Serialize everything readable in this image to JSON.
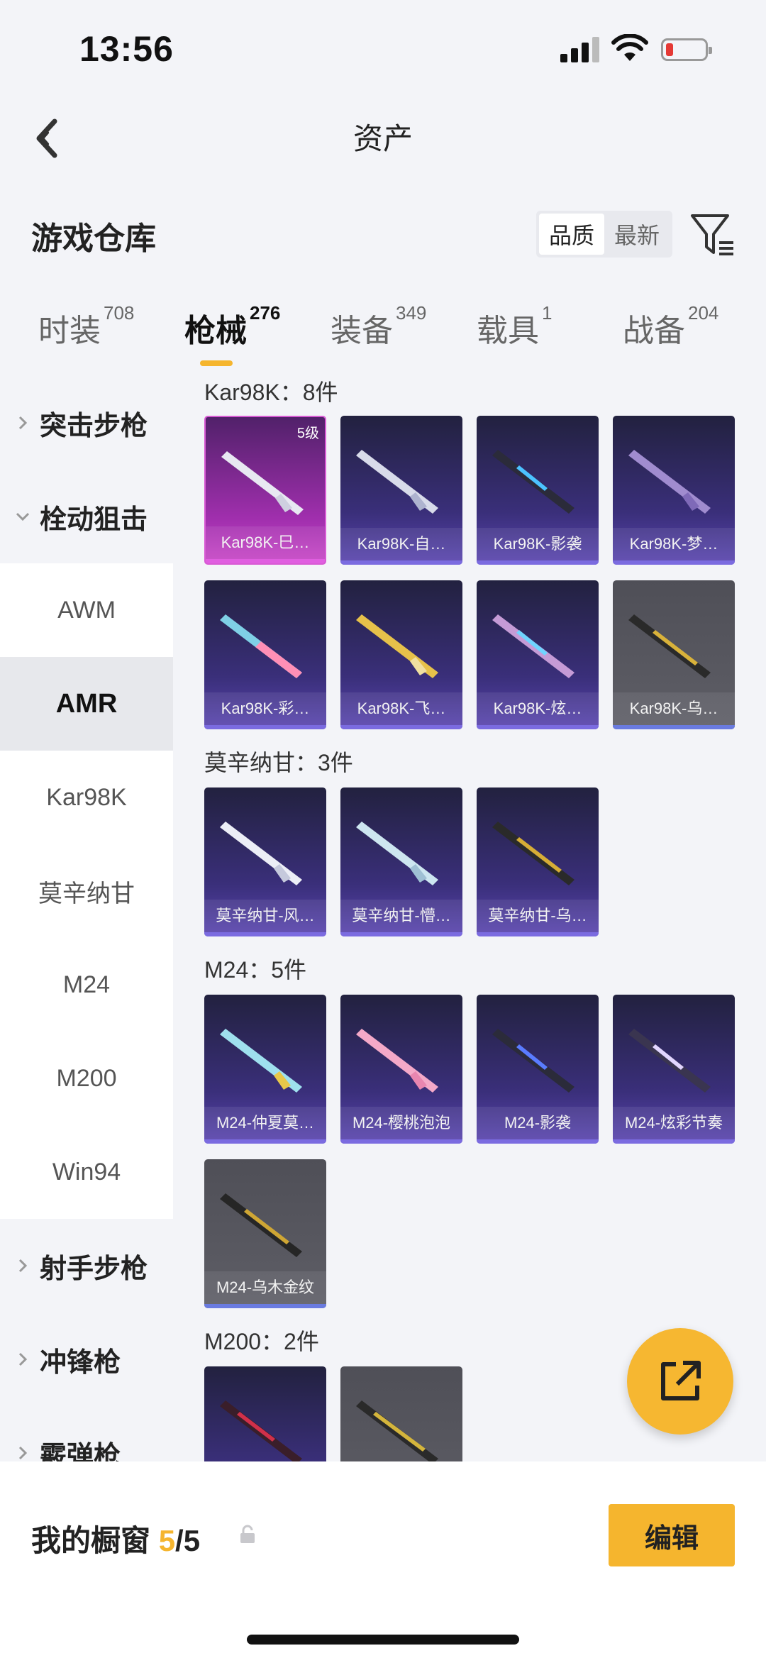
{
  "status_bar": {
    "time": "13:56"
  },
  "nav": {
    "title": "资产"
  },
  "warehouse": {
    "title": "游戏仓库",
    "sort_options": [
      "品质",
      "最新"
    ],
    "active_sort": "品质"
  },
  "tabs": [
    {
      "label": "时装",
      "count": "708"
    },
    {
      "label": "枪械",
      "count": "276"
    },
    {
      "label": "装备",
      "count": "349"
    },
    {
      "label": "载具",
      "count": "1"
    },
    {
      "label": "战备",
      "count": "204"
    }
  ],
  "active_tab": "枪械",
  "sidebar": {
    "items": [
      {
        "label": "突击步枪",
        "type": "group",
        "expanded": false
      },
      {
        "label": "栓动狙击",
        "type": "group",
        "expanded": true
      },
      {
        "label": "AWM",
        "type": "sub"
      },
      {
        "label": "AMR",
        "type": "sub",
        "selected": true
      },
      {
        "label": "Kar98K",
        "type": "sub"
      },
      {
        "label": "莫辛纳甘",
        "type": "sub"
      },
      {
        "label": "M24",
        "type": "sub"
      },
      {
        "label": "M200",
        "type": "sub"
      },
      {
        "label": "Win94",
        "type": "sub"
      },
      {
        "label": "射手步枪",
        "type": "group",
        "expanded": false
      },
      {
        "label": "冲锋枪",
        "type": "group",
        "expanded": false
      },
      {
        "label": "霰弹枪",
        "type": "group",
        "expanded": false
      }
    ]
  },
  "sections": [
    {
      "title": "Kar98K：8件",
      "items": [
        {
          "label": "Kar98K-巳…",
          "badge": "5级",
          "rarity": "legendary"
        },
        {
          "label": "Kar98K-自…",
          "rarity": "epic"
        },
        {
          "label": "Kar98K-影袭",
          "rarity": "epic"
        },
        {
          "label": "Kar98K-梦…",
          "rarity": "epic"
        },
        {
          "label": "Kar98K-彩…",
          "rarity": "epic"
        },
        {
          "label": "Kar98K-飞…",
          "rarity": "epic"
        },
        {
          "label": "Kar98K-炫…",
          "rarity": "epic"
        },
        {
          "label": "Kar98K-乌…",
          "rarity": "grey"
        }
      ]
    },
    {
      "title": "莫辛纳甘：3件",
      "items": [
        {
          "label": "莫辛纳甘-风…",
          "rarity": "epic"
        },
        {
          "label": "莫辛纳甘-懵…",
          "rarity": "epic"
        },
        {
          "label": "莫辛纳甘-乌…",
          "rarity": "epic"
        }
      ]
    },
    {
      "title": "M24：5件",
      "items": [
        {
          "label": "M24-仲夏莫…",
          "rarity": "epic"
        },
        {
          "label": "M24-樱桃泡泡",
          "rarity": "epic"
        },
        {
          "label": "M24-影袭",
          "rarity": "epic"
        },
        {
          "label": "M24-炫彩节奏",
          "rarity": "epic"
        },
        {
          "label": "M24-乌木金纹",
          "rarity": "grey"
        }
      ]
    },
    {
      "title": "M200：2件",
      "items": [
        {
          "label": "",
          "rarity": "epic"
        },
        {
          "label": "",
          "rarity": "grey"
        }
      ]
    }
  ],
  "bottom_bar": {
    "showcase_label": "我的橱窗",
    "showcase_current": "5",
    "showcase_total": "/5",
    "edit_label": "编辑"
  },
  "colors": {
    "accent": "#f5b52e",
    "epic_card": "#3a2f7a",
    "legendary_card": "#a12fae",
    "grey_card": "#5e5e66"
  }
}
